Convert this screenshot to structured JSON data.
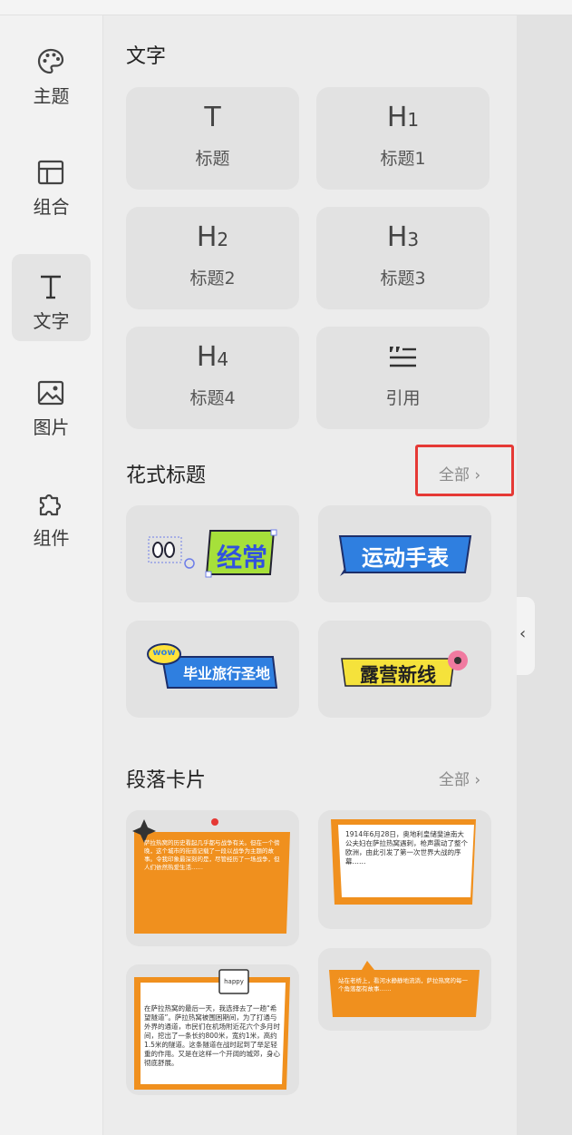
{
  "sidebar": {
    "items": [
      {
        "label": "主题",
        "icon": "palette-icon"
      },
      {
        "label": "组合",
        "icon": "layout-icon"
      },
      {
        "label": "文字",
        "icon": "text-icon",
        "active": true
      },
      {
        "label": "图片",
        "icon": "image-icon"
      },
      {
        "label": "组件",
        "icon": "puzzle-icon"
      }
    ]
  },
  "text_section": {
    "title": "文字",
    "tiles": [
      {
        "glyph": "T",
        "sub": "",
        "label": "标题"
      },
      {
        "glyph": "H",
        "sub": "1",
        "label": "标题1"
      },
      {
        "glyph": "H",
        "sub": "2",
        "label": "标题2"
      },
      {
        "glyph": "H",
        "sub": "3",
        "label": "标题3"
      },
      {
        "glyph": "H",
        "sub": "4",
        "label": "标题4"
      },
      {
        "glyph": "quote",
        "sub": "",
        "label": "引用"
      }
    ]
  },
  "fancy_section": {
    "title": "花式标题",
    "more": "全部",
    "cards": [
      {
        "text": "经常",
        "accent": "#a6e03a"
      },
      {
        "text": "运动手表",
        "accent": "#2f7fe0"
      },
      {
        "badge": "wow",
        "text": "毕业旅行圣地",
        "accent": "#2f7fe0"
      },
      {
        "text": "露营新线",
        "accent": "#f5e23b"
      }
    ]
  },
  "para_section": {
    "title": "段落卡片",
    "more": "全部",
    "cards": [
      {
        "text": "萨拉热窝的历史看起几乎都与战争有关。但在一个傍晚，这个城市的街道记载了一段以战争为主题的故事。令我印象最深刻的是，尽管经历了一场战争，但人们依然热爱生活……",
        "accent": "#f0901e"
      },
      {
        "text": "1914年6月28日，奥地利皇储斐迪南大公夫妇在萨拉热窝遇刺，枪声震动了整个欧洲，由此引发了第一次世界大战的序幕……",
        "accent": "#f0901e"
      },
      {
        "badge": "happy",
        "text": "在萨拉热窝的最后一天，我选择去了一趟“希望隧道”。萨拉热窝被围困期间，为了打通与外界的通道，市民们在机场附近花六个多月时间，挖出了一条长约800米，宽约1米，高约1.5米的隧道。这条隧道在战时起到了举足轻重的作用。又是在这样一个开阔的城郊，身心彻底舒展。",
        "accent": "#f0901e"
      },
      {
        "text": "站在老桥上，看河水静静地流淌，萨拉热窝的每一个角落都有故事……",
        "accent": "#f0901e"
      }
    ]
  },
  "collapse": {
    "icon": "chevron-left-icon",
    "label": "‹"
  }
}
